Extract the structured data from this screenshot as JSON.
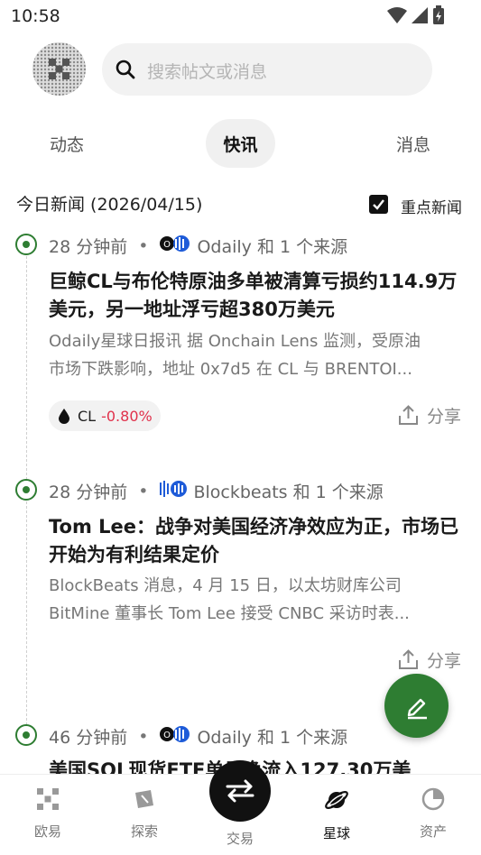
{
  "status_bar": {
    "time": "10:58"
  },
  "search": {
    "placeholder": "搜索帖文或消息"
  },
  "tabs": [
    {
      "label": "动态",
      "active": false
    },
    {
      "label": "快讯",
      "active": true
    },
    {
      "label": "消息",
      "active": false
    }
  ],
  "section": {
    "title": "今日新闻 (2026/04/15)",
    "filter_label": "重点新闻",
    "filter_checked": true
  },
  "news": [
    {
      "time": "28 分钟前",
      "source": "Odaily 和 1 个来源",
      "headline": "巨鲸CL与布伦特原油多单被清算亏损约114.9万美元，另一地址浮亏超380万美元",
      "summary_lines": [
        "Odaily星球日报讯 据 Onchain Lens 监测，受原油",
        "市场下跌影响，地址 0x7d5 在 CL 与 BRENTOI..."
      ],
      "ticker": {
        "symbol": "CL",
        "change": "-0.80%"
      },
      "share_label": "分享"
    },
    {
      "time": "28 分钟前",
      "source": "Blockbeats 和 1 个来源",
      "headline": "Tom Lee：战争对美国经济净效应为正，市场已开始为有利结果定价",
      "summary_lines": [
        "BlockBeats 消息，4 月 15 日，以太坊财库公司",
        "BitMine 董事长 Tom Lee 接受 CNBC 采访时表..."
      ],
      "share_label": "分享"
    },
    {
      "time": "46 分钟前",
      "source": "Odaily 和 1 个来源",
      "headline": "美国SOL现货ETF单日净流入127.30万美"
    }
  ],
  "bottom_nav": [
    {
      "label": "欧易",
      "icon": "okx-logo-icon"
    },
    {
      "label": "探索",
      "icon": "compass-icon"
    },
    {
      "label": "交易",
      "icon": "swap-arrows-icon"
    },
    {
      "label": "星球",
      "icon": "planet-icon",
      "active": true
    },
    {
      "label": "资产",
      "icon": "pie-chart-icon"
    }
  ],
  "colors": {
    "accent": "#2e7d32",
    "negative": "#e0314b"
  }
}
